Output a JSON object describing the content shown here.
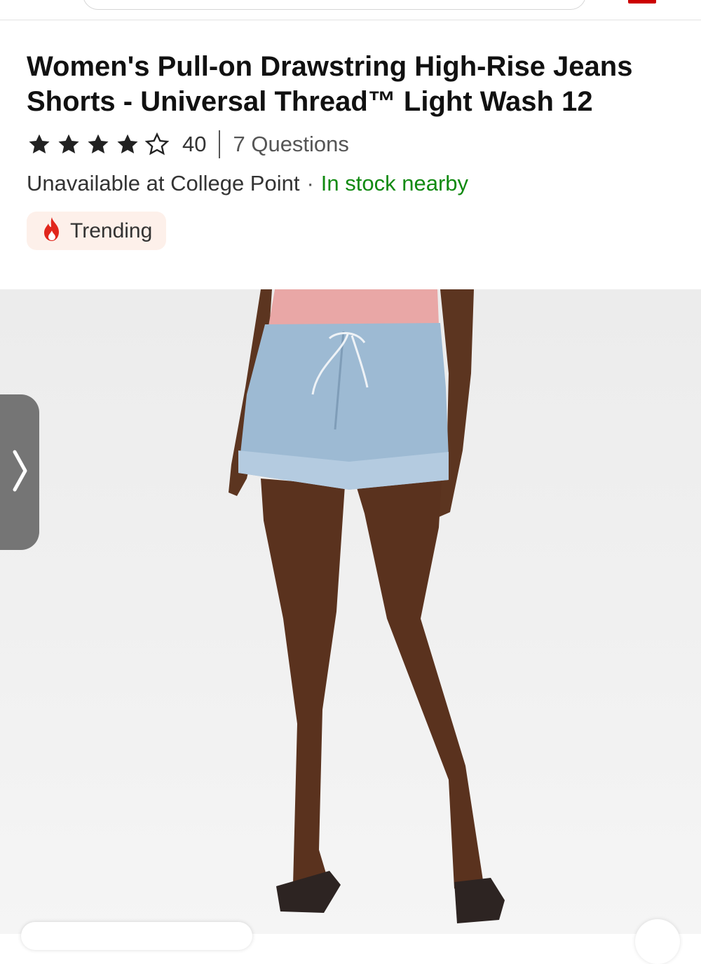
{
  "product": {
    "title": "Women's Pull-on Drawstring High-Rise Jeans Shorts - Universal Thread™ Light Wash 12",
    "rating": 4,
    "rating_max": 5,
    "review_count": "40",
    "questions": "7 Questions"
  },
  "availability": {
    "store_status": "Unavailable at College Point",
    "separator": "·",
    "nearby_status": "In stock nearby"
  },
  "badge": {
    "icon": "fire-icon",
    "label": "Trending"
  },
  "colors": {
    "brand_red": "#cc0000",
    "in_stock_green": "#118a11",
    "badge_bg": "#fdf0ea"
  },
  "carousel": {
    "next_icon": "chevron-right-icon"
  }
}
